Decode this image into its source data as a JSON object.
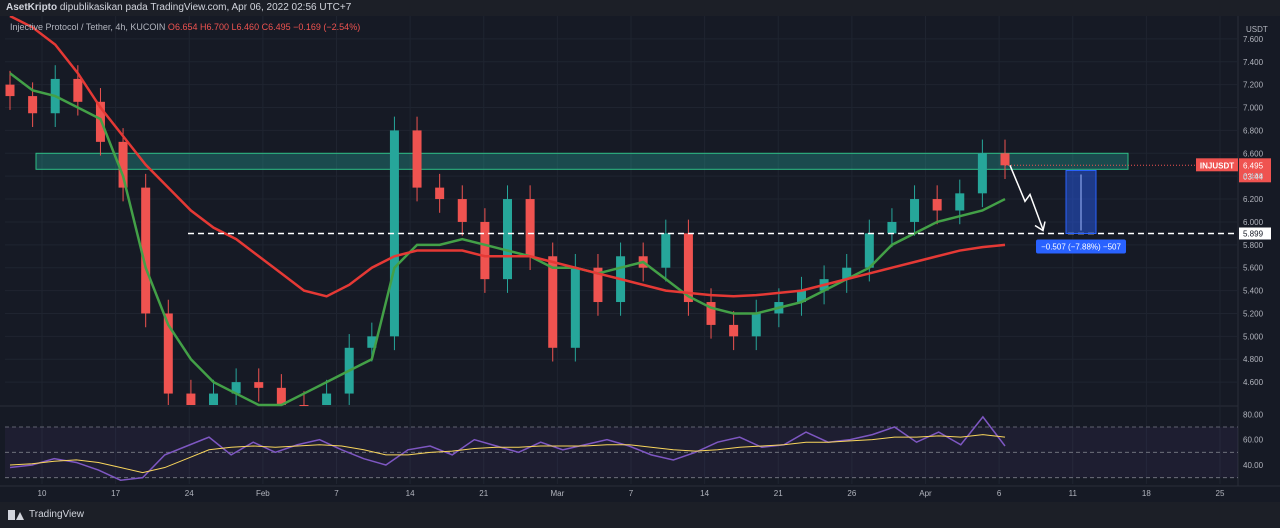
{
  "header": {
    "author": "AsetKripto",
    "published_text": "dipublikasikan pada TradingView.com, Apr 06, 2022 02:56 UTC+7"
  },
  "legend": {
    "symbol_text": "Injective Protocol / Tether, 4h, KUCOIN",
    "open_label": "O",
    "open": "6.654",
    "high_label": "H",
    "high": "6.700",
    "low_label": "L",
    "low": "6.460",
    "close_label": "C",
    "close": "6.495",
    "change": "−0.169 (−2.54%)"
  },
  "price_axis": {
    "currency": "USDT",
    "ticks": [
      "7.600",
      "7.400",
      "7.200",
      "7.000",
      "6.800",
      "6.600",
      "6.400",
      "6.200",
      "6.000",
      "5.800",
      "5.600",
      "5.400",
      "5.200",
      "5.000",
      "4.800",
      "4.600"
    ]
  },
  "rsi_axis": {
    "ticks": [
      "80.00",
      "60.00",
      "40.00"
    ]
  },
  "time_axis": {
    "ticks": [
      "10",
      "17",
      "24",
      "Feb",
      "7",
      "14",
      "21",
      "Mar",
      "7",
      "14",
      "21",
      "26",
      "Apr",
      "6",
      "11",
      "18",
      "25"
    ]
  },
  "badges": {
    "symbol": "INJUSDT",
    "price": "6.495",
    "countdown": "03:44",
    "target_level": "5.899",
    "measure": "−0.507 (−7.88%) −507"
  },
  "colors": {
    "up": "#26a69a",
    "down": "#ef5350",
    "ma_fast": "#43a047",
    "ma_slow": "#e53935",
    "rsi": "#7e57c2",
    "rsi_ma": "#f9d65c",
    "zone": "#26a69a",
    "measure": "#2962ff"
  },
  "footer": {
    "brand": "TradingView"
  },
  "chart_data": {
    "type": "candlestick",
    "title": "Injective Protocol / Tether, 4h, KUCOIN",
    "ylim": [
      4.4,
      7.8
    ],
    "x_ticks": [
      "10",
      "17",
      "24",
      "Feb",
      "7",
      "14",
      "21",
      "Mar",
      "7",
      "14",
      "21",
      "26",
      "Apr",
      "6",
      "11",
      "18",
      "25"
    ],
    "resistance_zone": [
      6.46,
      6.6
    ],
    "target_line": 5.899,
    "projected_change": "−0.507 (−7.88%)",
    "series": [
      {
        "name": "close",
        "values": [
          7.1,
          6.95,
          7.25,
          7.05,
          6.7,
          6.3,
          5.2,
          4.5,
          4.3,
          4.5,
          4.6,
          4.55,
          4.4,
          4.3,
          4.5,
          4.9,
          5.0,
          6.8,
          6.3,
          6.2,
          6.0,
          5.5,
          6.2,
          5.7,
          4.9,
          5.6,
          5.3,
          5.7,
          5.6,
          5.9,
          5.3,
          5.1,
          5.0,
          5.2,
          5.3,
          5.4,
          5.5,
          5.6,
          5.9,
          6.0,
          6.2,
          6.1,
          6.25,
          6.6,
          6.495
        ]
      },
      {
        "name": "ma_fast",
        "values": [
          7.3,
          7.15,
          7.1,
          7.0,
          6.9,
          6.4,
          5.6,
          5.1,
          4.8,
          4.6,
          4.5,
          4.4,
          4.4,
          4.5,
          4.6,
          4.7,
          4.8,
          5.6,
          5.8,
          5.8,
          5.85,
          5.8,
          5.75,
          5.7,
          5.6,
          5.6,
          5.55,
          5.6,
          5.65,
          5.5,
          5.35,
          5.25,
          5.2,
          5.2,
          5.25,
          5.3,
          5.4,
          5.5,
          5.6,
          5.8,
          5.9,
          6.0,
          6.05,
          6.1,
          6.2
        ]
      },
      {
        "name": "ma_slow",
        "values": [
          7.8,
          7.7,
          7.55,
          7.3,
          7.0,
          6.75,
          6.5,
          6.3,
          6.1,
          5.95,
          5.85,
          5.7,
          5.55,
          5.4,
          5.35,
          5.45,
          5.6,
          5.7,
          5.75,
          5.75,
          5.75,
          5.7,
          5.7,
          5.7,
          5.65,
          5.6,
          5.55,
          5.5,
          5.45,
          5.4,
          5.38,
          5.36,
          5.35,
          5.36,
          5.38,
          5.4,
          5.45,
          5.5,
          5.55,
          5.6,
          5.65,
          5.7,
          5.75,
          5.78,
          5.8
        ]
      }
    ],
    "rsi": {
      "ylim": [
        25,
        85
      ],
      "bands": [
        70,
        50,
        30
      ],
      "values": [
        38,
        40,
        45,
        42,
        36,
        28,
        30,
        48,
        55,
        62,
        48,
        58,
        50,
        56,
        60,
        52,
        45,
        40,
        52,
        55,
        48,
        60,
        55,
        50,
        58,
        52,
        56,
        60,
        55,
        48,
        44,
        50,
        58,
        62,
        54,
        56,
        66,
        58,
        60,
        64,
        70,
        58,
        66,
        56,
        78,
        55
      ],
      "ma_values": [
        40,
        41,
        43,
        44,
        42,
        38,
        34,
        38,
        45,
        52,
        54,
        55,
        54,
        55,
        56,
        55,
        52,
        48,
        48,
        50,
        51,
        53,
        54,
        54,
        55,
        55,
        55,
        56,
        56,
        54,
        52,
        51,
        52,
        54,
        55,
        56,
        58,
        58,
        59,
        60,
        62,
        62,
        63,
        62,
        64,
        62
      ]
    }
  }
}
